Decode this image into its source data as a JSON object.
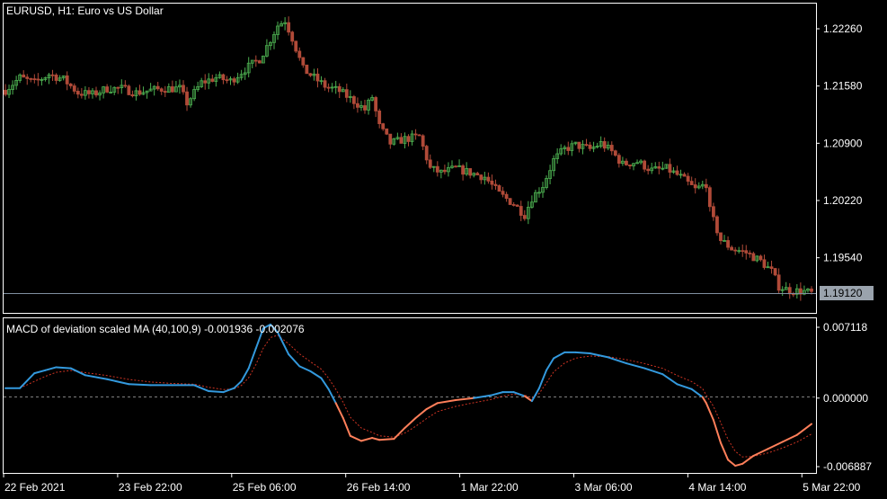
{
  "window": {
    "title": "EURUSD, H1:  Euro vs US Dollar"
  },
  "indicator": {
    "label": "MACD of deviation scaled MA (40,100,9) -0.001936 -0.002076"
  },
  "colors": {
    "background": "#000000",
    "frame": "#ffffff",
    "bull_candle": "#4caf50",
    "bear_candle": "#b04a38",
    "bid_line": "#7f8fa0",
    "price_badge": "#9aa3ad",
    "macd_up": "#3399dd",
    "macd_down": "#ff7f5a",
    "signal": "#cc3322",
    "zero_line": "#808080"
  },
  "price_axis": {
    "ticks": [
      "1.22260",
      "1.21580",
      "1.20900",
      "1.20220",
      "1.19540"
    ],
    "current": "1.19120"
  },
  "indicator_axis": {
    "ticks": [
      "0.007118",
      "0.000000",
      "-0.006887"
    ]
  },
  "time_axis": {
    "labels": [
      "22 Feb 2021",
      "23 Feb 22:00",
      "25 Feb 06:00",
      "26 Feb 14:00",
      "1 Mar 22:00",
      "3 Mar 06:00",
      "4 Mar 14:00",
      "5 Mar 22:00"
    ]
  },
  "chart_data": [
    {
      "type": "candlestick",
      "symbol": "EURUSD",
      "timeframe": "H1",
      "ylim": [
        1.1912,
        1.2236
      ],
      "current_price": 1.1912,
      "close_path": [
        [
          0,
          1.2153
        ],
        [
          4,
          1.2168
        ],
        [
          8,
          1.2162
        ],
        [
          12,
          1.2172
        ],
        [
          16,
          1.2166
        ],
        [
          20,
          1.215
        ],
        [
          24,
          1.2148
        ],
        [
          28,
          1.2155
        ],
        [
          32,
          1.2155
        ],
        [
          36,
          1.215
        ],
        [
          40,
          1.2153
        ],
        [
          44,
          1.2155
        ],
        [
          48,
          1.2155
        ],
        [
          50,
          1.2138
        ],
        [
          54,
          1.2162
        ],
        [
          58,
          1.2168
        ],
        [
          62,
          1.2164
        ],
        [
          66,
          1.2178
        ],
        [
          70,
          1.219
        ],
        [
          72,
          1.2205
        ],
        [
          75,
          1.223
        ],
        [
          77,
          1.2236
        ],
        [
          79,
          1.2215
        ],
        [
          82,
          1.2178
        ],
        [
          85,
          1.2168
        ],
        [
          88,
          1.2158
        ],
        [
          92,
          1.2152
        ],
        [
          96,
          1.214
        ],
        [
          99,
          1.213
        ],
        [
          101,
          1.2145
        ],
        [
          103,
          1.211
        ],
        [
          106,
          1.209
        ],
        [
          110,
          1.2095
        ],
        [
          114,
          1.2098
        ],
        [
          117,
          1.206
        ],
        [
          120,
          1.2055
        ],
        [
          124,
          1.206
        ],
        [
          128,
          1.2055
        ],
        [
          132,
          1.205
        ],
        [
          136,
          1.203
        ],
        [
          140,
          1.2018
        ],
        [
          143,
          1.2005
        ],
        [
          145,
          1.2025
        ],
        [
          148,
          1.204
        ],
        [
          151,
          1.207
        ],
        [
          154,
          1.2083
        ],
        [
          157,
          1.2088
        ],
        [
          161,
          1.2083
        ],
        [
          164,
          1.209
        ],
        [
          167,
          1.208
        ],
        [
          170,
          1.2065
        ],
        [
          174,
          1.2068
        ],
        [
          178,
          1.2058
        ],
        [
          182,
          1.206
        ],
        [
          186,
          1.205
        ],
        [
          190,
          1.2035
        ],
        [
          193,
          1.2042
        ],
        [
          194,
          1.201
        ],
        [
          197,
          1.1975
        ],
        [
          200,
          1.1965
        ],
        [
          204,
          1.196
        ],
        [
          208,
          1.195
        ],
        [
          211,
          1.1938
        ],
        [
          213,
          1.192
        ],
        [
          216,
          1.1915
        ],
        [
          220,
          1.1914
        ],
        [
          222,
          1.1912
        ]
      ]
    },
    {
      "type": "line",
      "title": "MACD of deviation scaled MA (40,100,9)",
      "ylim": [
        -0.006887,
        0.007118
      ],
      "x": [
        0,
        4,
        8,
        11,
        14,
        18,
        22,
        28,
        34,
        40,
        46,
        52,
        56,
        60,
        63,
        65,
        67,
        69,
        71,
        73,
        75,
        78,
        81,
        84,
        87,
        89,
        91,
        93,
        95,
        98,
        101,
        103,
        107,
        110,
        113,
        116,
        119,
        124,
        129,
        134,
        137,
        140,
        143,
        145,
        147,
        149,
        151,
        154,
        157,
        161,
        166,
        171,
        176,
        181,
        185,
        189,
        192,
        193,
        195,
        197,
        199,
        201,
        203,
        206,
        210,
        214,
        218,
        222
      ],
      "series": [
        {
          "values": [
            0.001,
            0.001,
            0.0025,
            0.0028,
            0.0031,
            0.003,
            0.0023,
            0.0019,
            0.0014,
            0.0013,
            0.0013,
            0.0013,
            0.0007,
            0.0006,
            0.001,
            0.0017,
            0.003,
            0.005,
            0.007,
            0.0074,
            0.0066,
            0.0044,
            0.0032,
            0.0027,
            0.002,
            0.0009,
            -0.0005,
            -0.002,
            -0.0038,
            -0.0043,
            -0.004,
            -0.0042,
            -0.0041,
            -0.003,
            -0.002,
            -0.0011,
            -0.0005,
            -0.0002,
            0.0,
            0.0003,
            0.0006,
            0.0006,
            0.0002,
            -0.0003,
            0.001,
            0.0028,
            0.004,
            0.0046,
            0.0046,
            0.0045,
            0.0041,
            0.0035,
            0.003,
            0.0024,
            0.0014,
            0.0009,
            0.0001,
            -0.0005,
            -0.0022,
            -0.0045,
            -0.0062,
            -0.0068,
            -0.0066,
            -0.0058,
            -0.0051,
            -0.0044,
            -0.0037,
            -0.0026
          ]
        }
      ]
    }
  ]
}
